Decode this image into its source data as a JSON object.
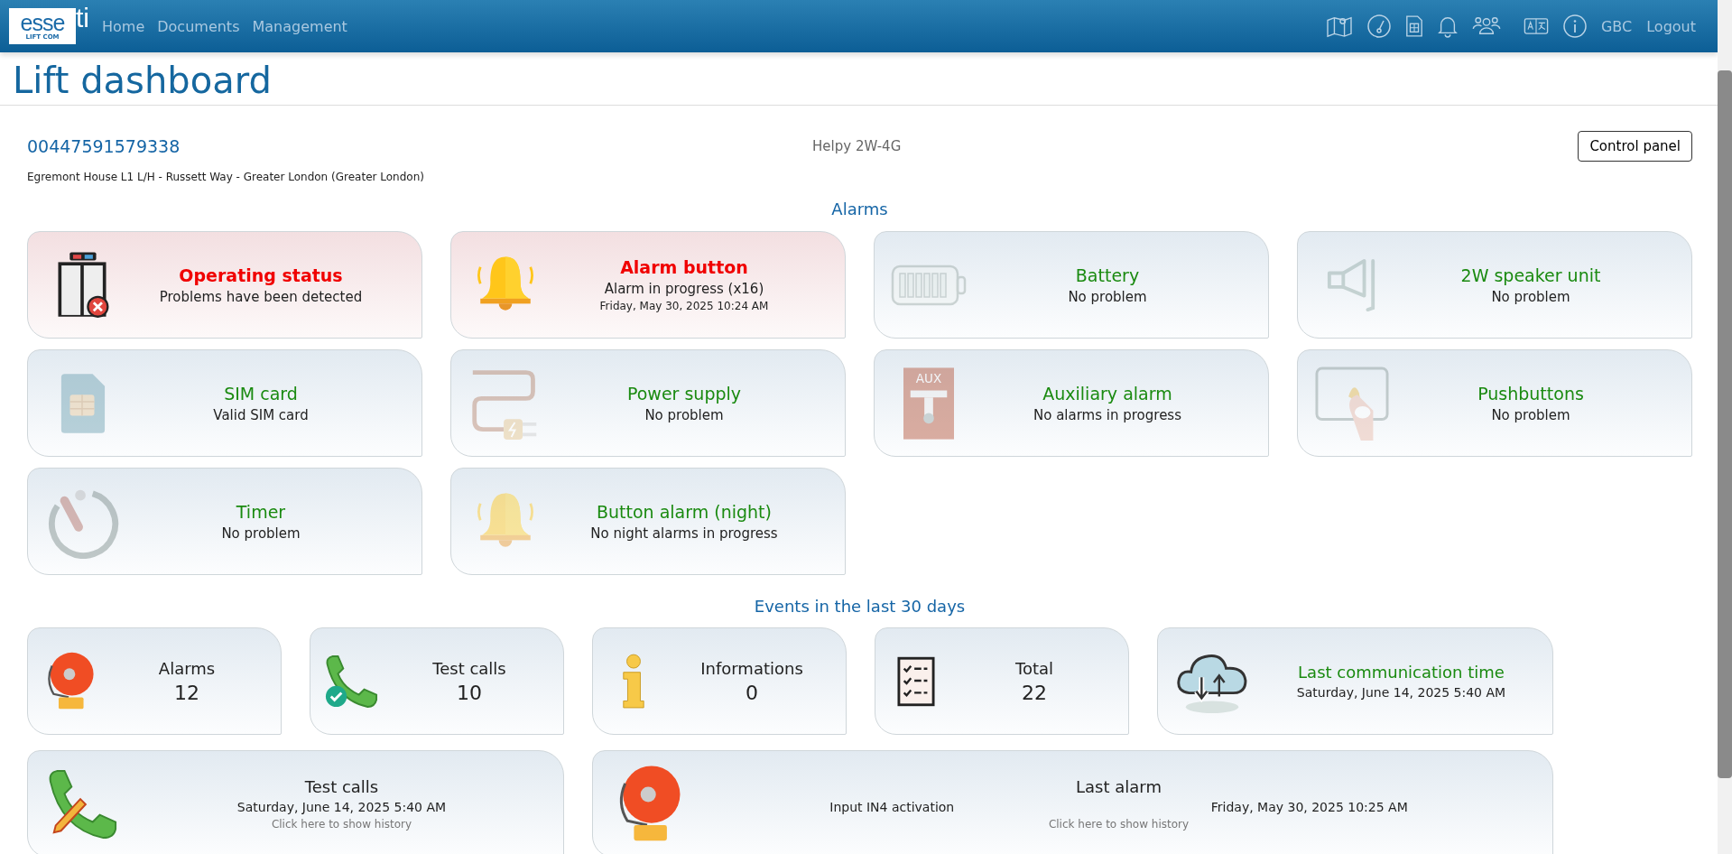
{
  "header": {
    "logo": {
      "main": "esse",
      "accent": "ti",
      "sub": "LIFT COM"
    },
    "nav": [
      {
        "label": "Home"
      },
      {
        "label": "Documents"
      },
      {
        "label": "Management"
      }
    ],
    "user": "GBC",
    "logout": "Logout"
  },
  "page": {
    "title": "Lift dashboard",
    "phone": "00447591579338",
    "model": "Helpy 2W-4G",
    "control_button": "Control panel",
    "address": "Egremont House L1 L/H - Russett Way - Greater London (Greater London)"
  },
  "alarms": {
    "heading": "Alarms",
    "cards": [
      {
        "title": "Operating status",
        "detail": "Problems have been detected",
        "problem": true
      },
      {
        "title": "Alarm button",
        "detail": "Alarm in progress (x16)",
        "time": "Friday, May 30, 2025 10:24 AM",
        "problem": true
      },
      {
        "title": "Battery",
        "detail": "No problem",
        "problem": false
      },
      {
        "title": "2W speaker unit",
        "detail": "No problem",
        "problem": false
      },
      {
        "title": "SIM card",
        "detail": "Valid SIM card",
        "problem": false
      },
      {
        "title": "Power supply",
        "detail": "No problem",
        "problem": false
      },
      {
        "title": "Auxiliary alarm",
        "detail": "No alarms in progress",
        "problem": false,
        "icon_label": "AUX"
      },
      {
        "title": "Pushbuttons",
        "detail": "No problem",
        "problem": false
      },
      {
        "title": "Timer",
        "detail": "No problem",
        "problem": false
      },
      {
        "title": "Button alarm (night)",
        "detail": "No night alarms in progress",
        "problem": false
      }
    ]
  },
  "events": {
    "heading": "Events in the last 30 days",
    "cards": [
      {
        "kind": "count",
        "label": "Alarms",
        "value": "12"
      },
      {
        "kind": "count",
        "label": "Test calls",
        "value": "10"
      },
      {
        "kind": "count",
        "label": "Informations",
        "value": "0"
      },
      {
        "kind": "count",
        "label": "Total",
        "value": "22"
      },
      {
        "kind": "time",
        "title": "Last communication time",
        "time": "Saturday, June 14, 2025 5:40 AM"
      },
      {
        "kind": "history",
        "title": "Test calls",
        "time": "Saturday, June 14, 2025 5:40 AM",
        "link": "Click here to show history"
      },
      {
        "kind": "history",
        "title": "Last alarm",
        "detail": "Input IN4 activation",
        "time": "Friday, May 30, 2025 10:25 AM",
        "link": "Click here to show history"
      }
    ]
  }
}
